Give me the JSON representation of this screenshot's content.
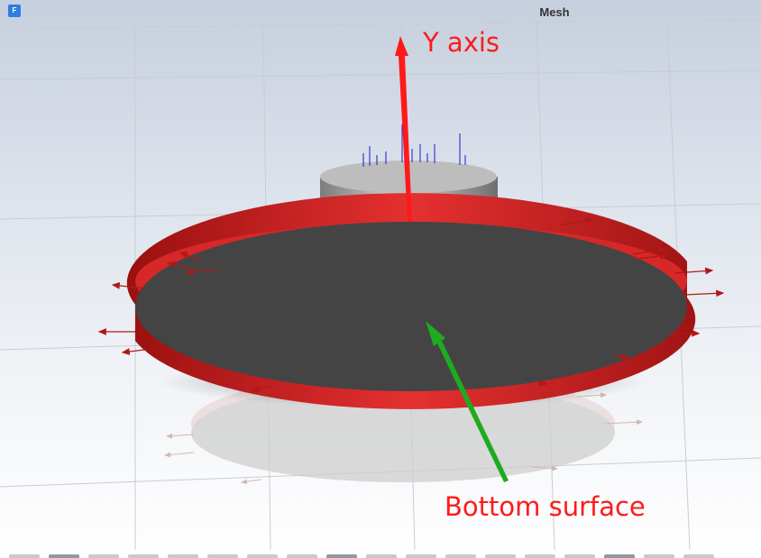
{
  "window": {
    "app_icon_glyph": "F",
    "title": "Mesh"
  },
  "annotations": {
    "y_axis_label": "Y axis",
    "bottom_surface_label": "Bottom surface",
    "y_axis_arrow_color": "#ff1a1a",
    "bottom_surface_arrow_color": "#1faa1f"
  },
  "model": {
    "disk_rim_color": "#cc1f1f",
    "disk_face_color": "#444444",
    "cylinder_color": "#a8a8a8",
    "force_arrow_color": "#b01818",
    "normal_vector_color": "#1a1acc"
  },
  "toolbar": {
    "tabs": [
      "tab",
      "tab",
      "tab",
      "tab",
      "tab",
      "tab",
      "tab",
      "tab",
      "tab",
      "tab",
      "tab",
      "tab",
      "tab",
      "tab",
      "tab",
      "tab",
      "tab",
      "tab"
    ],
    "active_tabs": [
      1,
      8,
      15
    ]
  }
}
